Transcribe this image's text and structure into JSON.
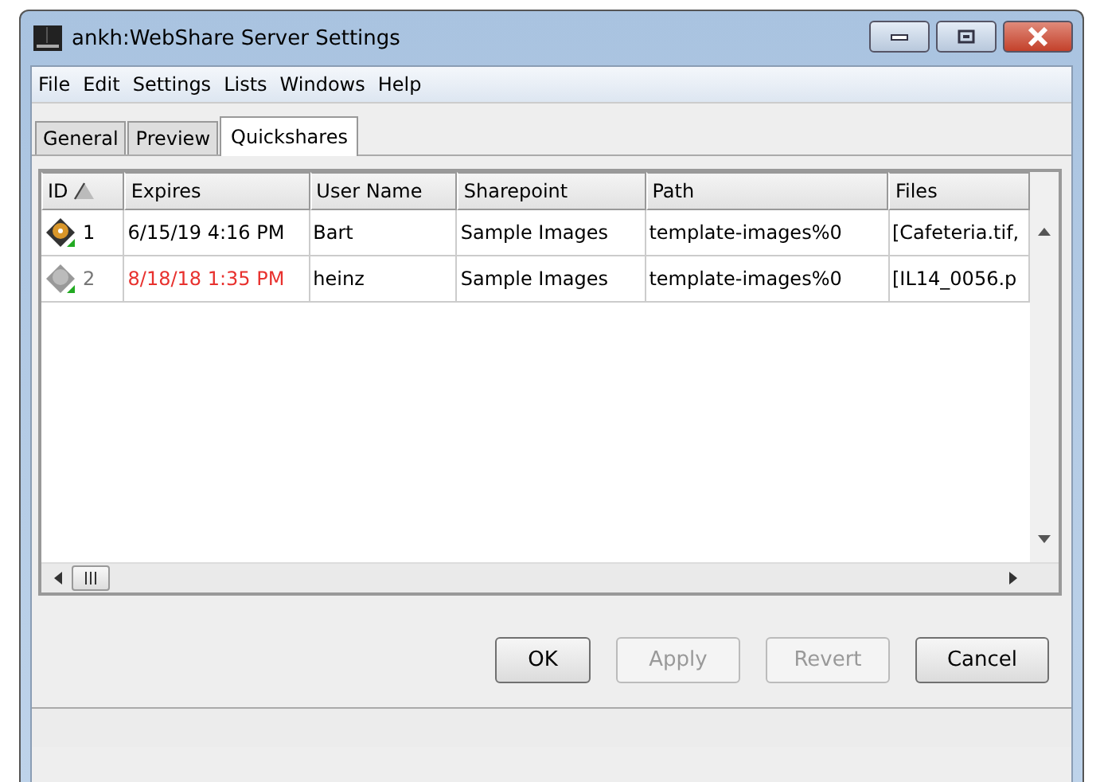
{
  "window": {
    "title": "ankh:WebShare Server Settings"
  },
  "menu": [
    "File",
    "Edit",
    "Settings",
    "Lists",
    "Windows",
    "Help"
  ],
  "tabs": [
    {
      "label": "General",
      "selected": false
    },
    {
      "label": "Preview",
      "selected": false
    },
    {
      "label": "Quickshares",
      "selected": true
    }
  ],
  "table": {
    "columns": [
      "ID",
      "Expires",
      "User Name",
      "Sharepoint",
      "Path",
      "Files"
    ],
    "rows": [
      {
        "id": "1",
        "expires": "6/15/19 4:16 PM",
        "user": "Bart",
        "sharepoint": "Sample Images",
        "path": "template-images%0",
        "files": "[Cafeteria.tif,",
        "expired": false
      },
      {
        "id": "2",
        "expires": "8/18/18 1:35 PM",
        "user": "heinz",
        "sharepoint": "Sample Images",
        "path": "template-images%0",
        "files": "[IL14_0056.p",
        "expired": true
      }
    ]
  },
  "buttons": [
    {
      "label": "OK",
      "disabled": false
    },
    {
      "label": "Apply",
      "disabled": true
    },
    {
      "label": "Revert",
      "disabled": true
    },
    {
      "label": "Cancel",
      "disabled": false
    }
  ]
}
